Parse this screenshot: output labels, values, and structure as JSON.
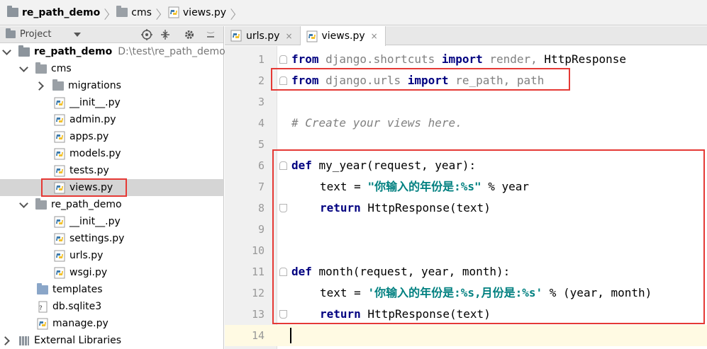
{
  "breadcrumb": {
    "project": "re_path_demo",
    "folder": "cms",
    "file": "views.py"
  },
  "project_panel": {
    "title": "Project",
    "tree": [
      {
        "label": "re_path_demo",
        "hint": "D:\\test\\re_path_demo",
        "expanded": true,
        "icon": "folder-icon"
      },
      {
        "label": "cms",
        "expanded": true,
        "icon": "folder-icon"
      },
      {
        "label": "migrations",
        "expanded": false,
        "icon": "folder-icon"
      },
      {
        "label": "__init__.py",
        "icon": "python-file-icon"
      },
      {
        "label": "admin.py",
        "icon": "python-file-icon"
      },
      {
        "label": "apps.py",
        "icon": "python-file-icon"
      },
      {
        "label": "models.py",
        "icon": "python-file-icon"
      },
      {
        "label": "tests.py",
        "icon": "python-file-icon"
      },
      {
        "label": "views.py",
        "icon": "python-file-icon",
        "selected": true
      },
      {
        "label": "re_path_demo",
        "expanded": true,
        "icon": "folder-icon"
      },
      {
        "label": "__init__.py",
        "icon": "python-file-icon"
      },
      {
        "label": "settings.py",
        "icon": "python-file-icon"
      },
      {
        "label": "urls.py",
        "icon": "python-file-icon"
      },
      {
        "label": "wsgi.py",
        "icon": "python-file-icon"
      },
      {
        "label": "templates",
        "icon": "folder-icon"
      },
      {
        "label": "db.sqlite3",
        "icon": "database-file-icon"
      },
      {
        "label": "manage.py",
        "icon": "python-file-icon"
      },
      {
        "label": "External Libraries",
        "icon": "library-icon"
      }
    ]
  },
  "tabs": [
    {
      "label": "urls.py",
      "close": "×",
      "active": false
    },
    {
      "label": "views.py",
      "close": "×",
      "active": true
    }
  ],
  "editor": {
    "line_numbers": [
      "1",
      "2",
      "3",
      "4",
      "5",
      "6",
      "7",
      "8",
      "9",
      "10",
      "11",
      "12",
      "13",
      "14"
    ],
    "lines": [
      {
        "segs": [
          [
            "kw",
            "from"
          ],
          [
            "gray",
            " django.shortcuts "
          ],
          [
            "kw",
            "import"
          ],
          [
            "gray",
            " render, "
          ],
          [
            "",
            "HttpResponse"
          ]
        ]
      },
      {
        "segs": [
          [
            "kw",
            "from"
          ],
          [
            "gray",
            " django.urls "
          ],
          [
            "kw",
            "import"
          ],
          [
            "gray",
            " re_path, path"
          ]
        ]
      },
      {
        "segs": []
      },
      {
        "segs": [
          [
            "cmt",
            "# Create your views here."
          ]
        ]
      },
      {
        "segs": []
      },
      {
        "segs": [
          [
            "kw",
            "def"
          ],
          [
            "",
            " my_year(request, year):"
          ]
        ]
      },
      {
        "segs": [
          [
            "",
            " text = "
          ],
          [
            "str",
            "\"你输入的年份是:%s\""
          ],
          [
            "",
            " % year"
          ]
        ]
      },
      {
        "segs": [
          [
            "",
            " "
          ],
          [
            "kw",
            "return"
          ],
          [
            "",
            " HttpResponse(text)"
          ]
        ]
      },
      {
        "segs": []
      },
      {
        "segs": []
      },
      {
        "segs": [
          [
            "kw",
            "def"
          ],
          [
            "",
            " month(request, year, month):"
          ]
        ]
      },
      {
        "segs": [
          [
            "",
            " text = "
          ],
          [
            "str",
            "'你输入的年份是:%s,月份是:%s'"
          ],
          [
            "",
            " % (year, month)"
          ]
        ]
      },
      {
        "segs": [
          [
            "",
            " "
          ],
          [
            "kw",
            "return"
          ],
          [
            "",
            " HttpResponse(text)"
          ]
        ]
      },
      {
        "segs": []
      }
    ]
  },
  "colors": {
    "keyword": "#000080",
    "string": "#008080",
    "comment": "#808080",
    "highlight_box": "#e53935"
  }
}
